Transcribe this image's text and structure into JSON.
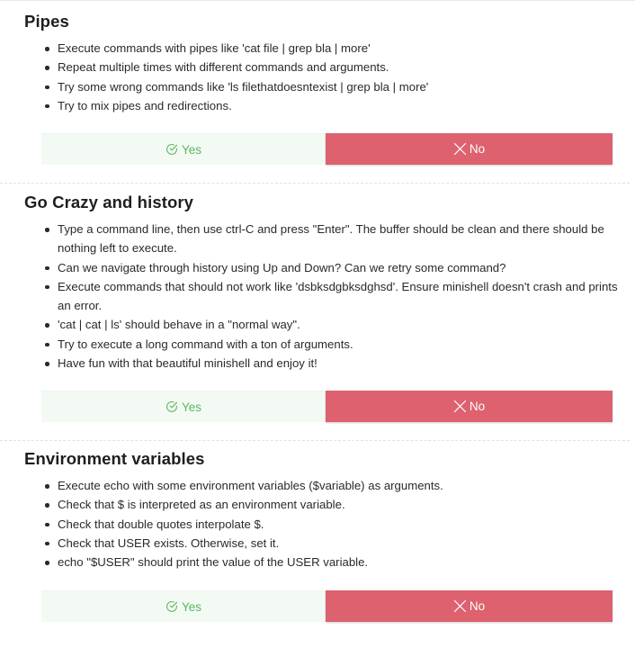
{
  "colors": {
    "yes_text": "#5cb85c",
    "yes_bg": "#f3faf4",
    "no_bg": "#dd616e",
    "no_text": "#ffffff"
  },
  "sections": [
    {
      "title": "Pipes",
      "items": [
        "Execute commands with pipes like 'cat file | grep bla | more'",
        "Repeat multiple times with different commands and arguments.",
        "Try some wrong commands like 'ls filethatdoesntexist | grep bla | more'",
        "Try to mix pipes and redirections."
      ],
      "yes_label": "Yes",
      "no_label": "No",
      "yes_icon": "check-circle-icon",
      "no_icon": "close-x-icon"
    },
    {
      "title": "Go Crazy and history",
      "items": [
        "Type a command line, then use ctrl-C and press \"Enter\". The buffer should be clean and there should be nothing left to execute.",
        "Can we navigate through history using Up and Down? Can we retry some command?",
        "Execute commands that should not work like 'dsbksdgbksdghsd'. Ensure minishell doesn't crash and prints an error.",
        "'cat | cat | ls' should behave in a \"normal way\".",
        "Try to execute a long command with a ton of arguments.",
        "Have fun with that beautiful minishell and enjoy it!"
      ],
      "yes_label": "Yes",
      "no_label": "No",
      "yes_icon": "check-circle-icon",
      "no_icon": "close-x-icon"
    },
    {
      "title": "Environment variables",
      "items": [
        "Execute echo with some environment variables ($variable) as arguments.",
        "Check that $ is interpreted as an environment variable.",
        "Check that double quotes interpolate $.",
        "Check that USER exists. Otherwise, set it.",
        "echo \"$USER\" should print the value of the USER variable."
      ],
      "yes_label": "Yes",
      "no_label": "No",
      "yes_icon": "check-circle-icon",
      "no_icon": "close-x-icon"
    }
  ]
}
